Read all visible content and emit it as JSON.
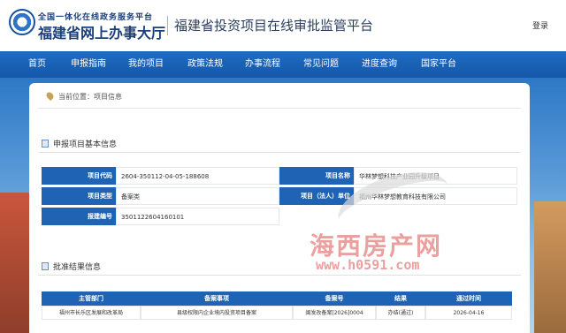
{
  "header": {
    "brand_top": "全国一体化在线政务服务平台",
    "brand_main": "福建省网上办事大厅",
    "site_title": "福建省投资项目在线审批监管平台",
    "login": "登录"
  },
  "nav": [
    {
      "label": "首页"
    },
    {
      "label": "申报指南"
    },
    {
      "label": "我的项目"
    },
    {
      "label": "政策法规"
    },
    {
      "label": "办事流程"
    },
    {
      "label": "常见问题"
    },
    {
      "label": "进度查询"
    },
    {
      "label": "国家平台"
    }
  ],
  "breadcrumb": {
    "prefix": "当前位置：",
    "current": "项目信息"
  },
  "basic_info": {
    "title": "申报项目基本信息",
    "rows": {
      "code_label": "项目代码",
      "code_value": "2604-350112-04-05-188608",
      "name_label": "项目名称",
      "name_value": "华林梦想科技产业园升级项目",
      "type_label": "项目类型",
      "type_value": "备案类",
      "owner_label": "项目（法人）单位",
      "owner_value": "福州华林梦想教育科技有限公司",
      "report_label": "报建编号",
      "report_value": "3501122604160101"
    }
  },
  "results": {
    "title": "批准结果信息",
    "headers": [
      "主管部门",
      "备案事项",
      "备案号",
      "结果",
      "通过时间"
    ],
    "row": [
      "福州市长乐区发展和改革局",
      "县级权限内企业境内投资项目备案",
      "闽发改备案[2026]0004",
      "办结(通过)",
      "2026-04-16"
    ]
  },
  "watermark": {
    "main": "海西房产网",
    "url": "www.h0591.com"
  },
  "colors": {
    "nav_blue": "#1f6cc2",
    "label_blue": "#1f64b4",
    "watermark_red": "#d9534f"
  }
}
